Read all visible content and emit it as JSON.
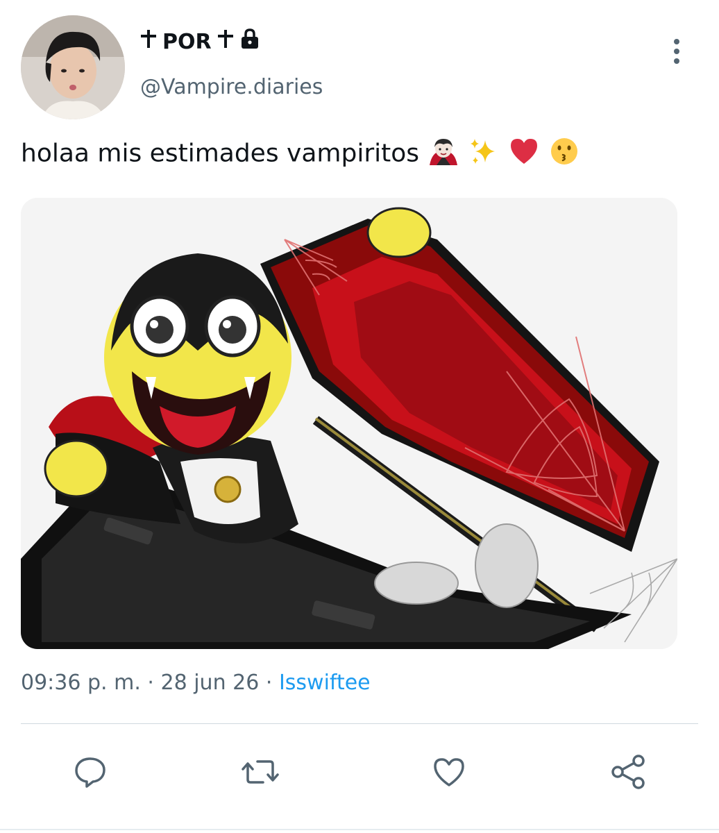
{
  "author": {
    "display_name": "POR",
    "handle": "@Vampire.diaries",
    "cross_icon": "latin-cross-icon",
    "lock_icon": "lock-icon"
  },
  "menu": {
    "icon": "more-vertical-icon"
  },
  "tweet": {
    "text": "holaa mis estimades vampiritos",
    "emojis": [
      "vampire-emoji",
      "sparkles-emoji",
      "red-heart-emoji",
      "kissing-face-emoji"
    ]
  },
  "media": {
    "description_icon": "vampire-smiley-in-coffin-image"
  },
  "meta": {
    "time": "09:36 p. m.",
    "separator": "·",
    "date": "28 jun 26",
    "source": "Isswiftee"
  },
  "actions": [
    {
      "name": "reply",
      "icon": "speech-bubble-icon"
    },
    {
      "name": "retweet",
      "icon": "retweet-icon"
    },
    {
      "name": "like",
      "icon": "heart-icon"
    },
    {
      "name": "share",
      "icon": "share-icon"
    }
  ],
  "colors": {
    "text": "#0f1419",
    "secondary": "#536471",
    "link": "#1d9bf0",
    "divider": "#cfd9de"
  }
}
